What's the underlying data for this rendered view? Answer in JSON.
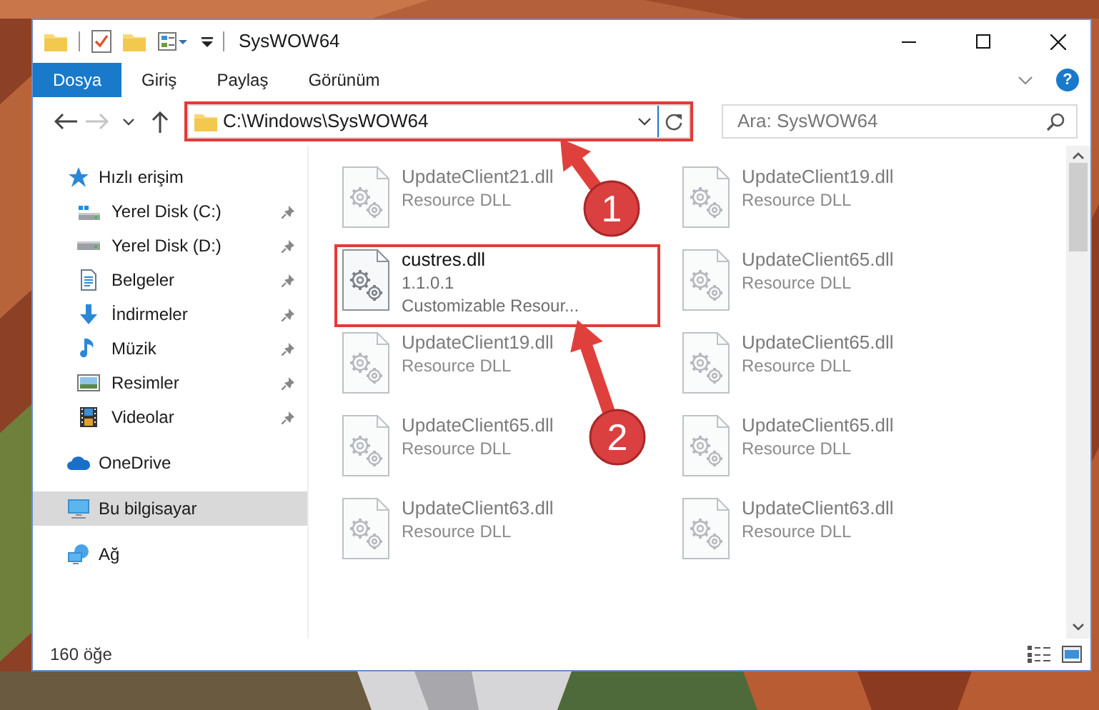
{
  "window": {
    "title": "SysWOW64"
  },
  "ribbon_tabs": [
    {
      "label": "Dosya",
      "selected": true
    },
    {
      "label": "Giriş",
      "selected": false
    },
    {
      "label": "Paylaş",
      "selected": false
    },
    {
      "label": "Görünüm",
      "selected": false
    }
  ],
  "help": "?",
  "navigation": {
    "back": {
      "disabled": false
    },
    "forward": {
      "disabled": true
    }
  },
  "address": {
    "path": "C:\\Windows\\SysWOW64",
    "highlighted": true
  },
  "search": {
    "placeholder": "Ara: SysWOW64"
  },
  "sidebar": {
    "items": [
      {
        "label": "Hızlı erişim",
        "selected": false,
        "pinned": false,
        "children": [
          {
            "label": "Yerel Disk (C:)",
            "selected": false,
            "pinned": true
          },
          {
            "label": "Yerel Disk (D:)",
            "selected": false,
            "pinned": true
          },
          {
            "label": "Belgeler",
            "selected": false,
            "pinned": true
          },
          {
            "label": "İndirmeler",
            "selected": false,
            "pinned": true
          },
          {
            "label": "Müzik",
            "selected": false,
            "pinned": true
          },
          {
            "label": "Resimler",
            "selected": false,
            "pinned": true
          },
          {
            "label": "Videolar",
            "selected": false,
            "pinned": true
          }
        ]
      },
      {
        "label": "OneDrive",
        "selected": false,
        "pinned": false
      },
      {
        "label": "Bu bilgisayar",
        "selected": true,
        "pinned": false
      },
      {
        "label": "Ağ",
        "selected": false,
        "pinned": false
      }
    ]
  },
  "files": [
    {
      "name": "UpdateClient21.dll",
      "details": [
        "Resource DLL"
      ],
      "blurred": true,
      "highlighted": false
    },
    {
      "name": "UpdateClient19.dll",
      "details": [
        "Resource DLL"
      ],
      "blurred": true,
      "highlighted": false
    },
    {
      "name": "custres.dll",
      "details": [
        "1.1.0.1",
        "Customizable Resour..."
      ],
      "blurred": false,
      "highlighted": true
    },
    {
      "name": "UpdateClient65.dll",
      "details": [
        "Resource DLL"
      ],
      "blurred": true,
      "highlighted": false
    },
    {
      "name": "UpdateClient19.dll",
      "details": [
        "Resource DLL"
      ],
      "blurred": true,
      "highlighted": false
    },
    {
      "name": "UpdateClient65.dll",
      "details": [
        "Resource DLL"
      ],
      "blurred": true,
      "highlighted": false
    },
    {
      "name": "UpdateClient65.dll",
      "details": [
        "Resource DLL"
      ],
      "blurred": true,
      "highlighted": false
    },
    {
      "name": "UpdateClient65.dll",
      "details": [
        "Resource DLL"
      ],
      "blurred": true,
      "highlighted": false
    },
    {
      "name": "UpdateClient63.dll",
      "details": [
        "Resource DLL"
      ],
      "blurred": true,
      "highlighted": false
    },
    {
      "name": "UpdateClient63.dll",
      "details": [
        "Resource DLL"
      ],
      "blurred": true,
      "highlighted": false
    }
  ],
  "status_bar": {
    "count": "160 öğe"
  },
  "annotations": [
    {
      "number": "1"
    },
    {
      "number": "2"
    }
  ]
}
